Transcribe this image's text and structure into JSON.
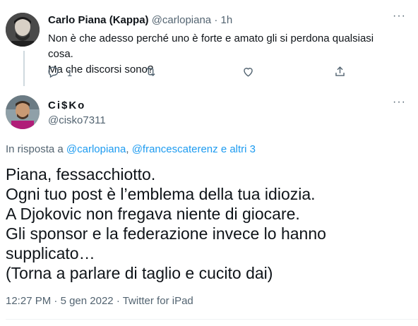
{
  "tweet1": {
    "author_name": "Carlo Piana (Kappa)",
    "handle": "@carlopiana",
    "separator": "·",
    "time": "1h",
    "text_lines": [
      "Non è che adesso perché uno è forte e amato gli si perdona qualsiasi cosa.",
      "Ma che discorsi sono?"
    ],
    "reply_count": "1",
    "more_label": "···"
  },
  "tweet2": {
    "author_name": "Ci$Ko",
    "handle": "@cisko7311",
    "more_label": "···",
    "reply_prefix": "In risposta a",
    "reply_to_1": "@carlopiana",
    "reply_sep": ",",
    "reply_to_2": "@francescaterenz",
    "reply_suffix": "e altri 3",
    "body_lines": [
      "Piana, fessacchiotto.",
      "Ogni tuo post è l’emblema della tua idiozia.",
      "A Djokovic non fregava niente di giocare.",
      "Gli sponsor e la federazione invece lo hanno",
      "supplicato…",
      "(Torna a parlare di taglio e cucito dai)"
    ],
    "time": "12:27 PM",
    "date": "5 gen 2022",
    "source": "Twitter for iPad",
    "meta_sep": "·"
  },
  "icons": [
    "reply-icon",
    "retweet-icon",
    "like-icon",
    "share-icon",
    "more-icon"
  ],
  "colors": {
    "accent": "#1d9bf0",
    "muted": "#536471",
    "text": "#0f1419"
  }
}
